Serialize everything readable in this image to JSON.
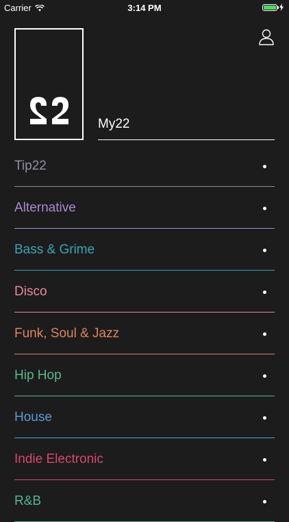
{
  "status_bar": {
    "carrier": "Carrier",
    "time": "3:14 PM",
    "battery_color": "#4cd964"
  },
  "header": {
    "logo_icon": "22-logo-icon",
    "user_icon": "user-icon"
  },
  "my22": {
    "label": "My22"
  },
  "genres": [
    {
      "label": "Tip22",
      "color": "#8f8fa8"
    },
    {
      "label": "Alternative",
      "color": "#a98ad6"
    },
    {
      "label": "Bass & Grime",
      "color": "#3aa6b7"
    },
    {
      "label": "Disco",
      "color": "#e88a9b"
    },
    {
      "label": "Funk, Soul & Jazz",
      "color": "#e0845c"
    },
    {
      "label": "Hip Hop",
      "color": "#5bb98a"
    },
    {
      "label": "House",
      "color": "#5b9bd5"
    },
    {
      "label": "Indie Electronic",
      "color": "#d9466c"
    },
    {
      "label": "R&B",
      "color": "#4fb88f"
    }
  ]
}
